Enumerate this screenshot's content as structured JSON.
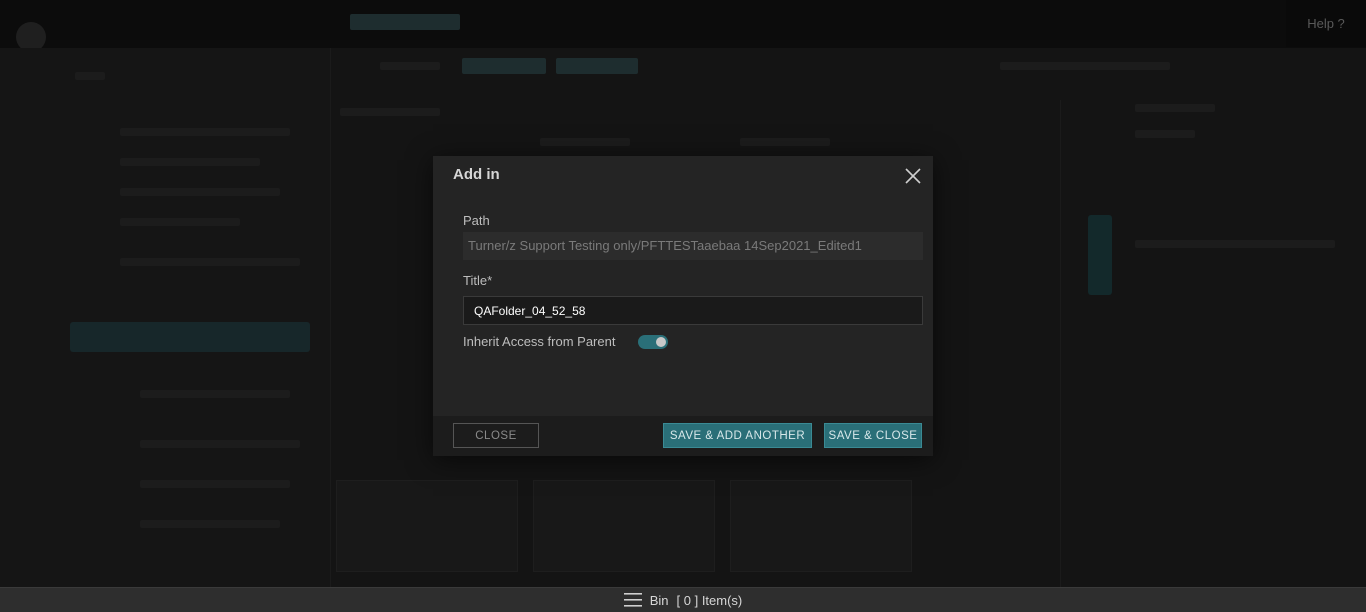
{
  "header": {
    "help_label": "Help ?"
  },
  "modal": {
    "title": "Add in",
    "path_label": "Path",
    "path_value": "Turner/z Support Testing only/PFTTESTaaebaa 14Sep2021_Edited1",
    "title_label": "Title*",
    "title_value": "QAFolder_04_52_58",
    "inherit_label": "Inherit Access from Parent",
    "inherit_enabled": true,
    "close_button": "CLOSE",
    "save_add_another_button": "SAVE & ADD ANOTHER",
    "save_close_button": "SAVE & CLOSE"
  },
  "bin": {
    "label": "Bin",
    "count_text": "[ 0 ] Item(s)"
  },
  "colors": {
    "accent": "#2a6f78",
    "modal_bg": "#242424",
    "footer_bg": "#1c1c1c"
  }
}
